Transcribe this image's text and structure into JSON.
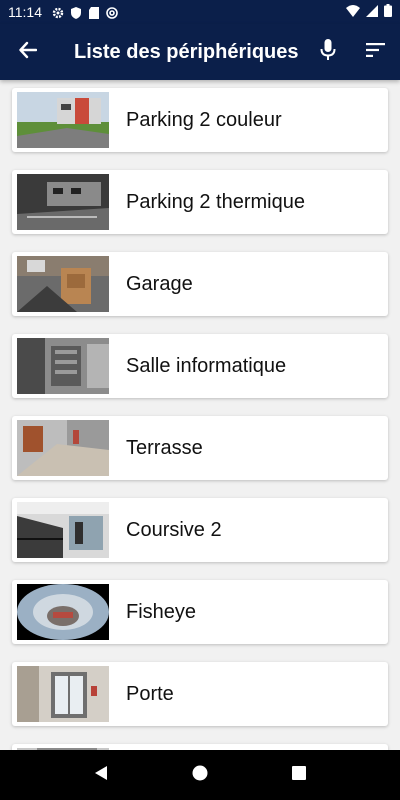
{
  "status": {
    "time": "11:14",
    "left_icons": [
      "settings-gear-icon",
      "shield-icon",
      "sd-card-icon",
      "at-symbol-icon"
    ],
    "right_icons": [
      "wifi-icon",
      "cellular-signal-icon",
      "battery-icon"
    ]
  },
  "header": {
    "title": "Liste des périphériques",
    "back_icon": "arrow-left-icon",
    "mic_icon": "microphone-icon",
    "sort_icon": "sort-icon"
  },
  "devices": [
    {
      "label": "Parking 2 couleur"
    },
    {
      "label": "Parking 2 thermique"
    },
    {
      "label": "Garage"
    },
    {
      "label": "Salle informatique"
    },
    {
      "label": "Terrasse"
    },
    {
      "label": "Coursive 2"
    },
    {
      "label": "Fisheye"
    },
    {
      "label": "Porte"
    },
    {
      "label": ""
    }
  ],
  "navbar": {
    "icons": [
      "back-triangle-icon",
      "home-circle-icon",
      "recents-square-icon"
    ]
  },
  "colors": {
    "appbar": "#0b1f4a",
    "background": "#f1f1f1",
    "card": "#ffffff"
  }
}
